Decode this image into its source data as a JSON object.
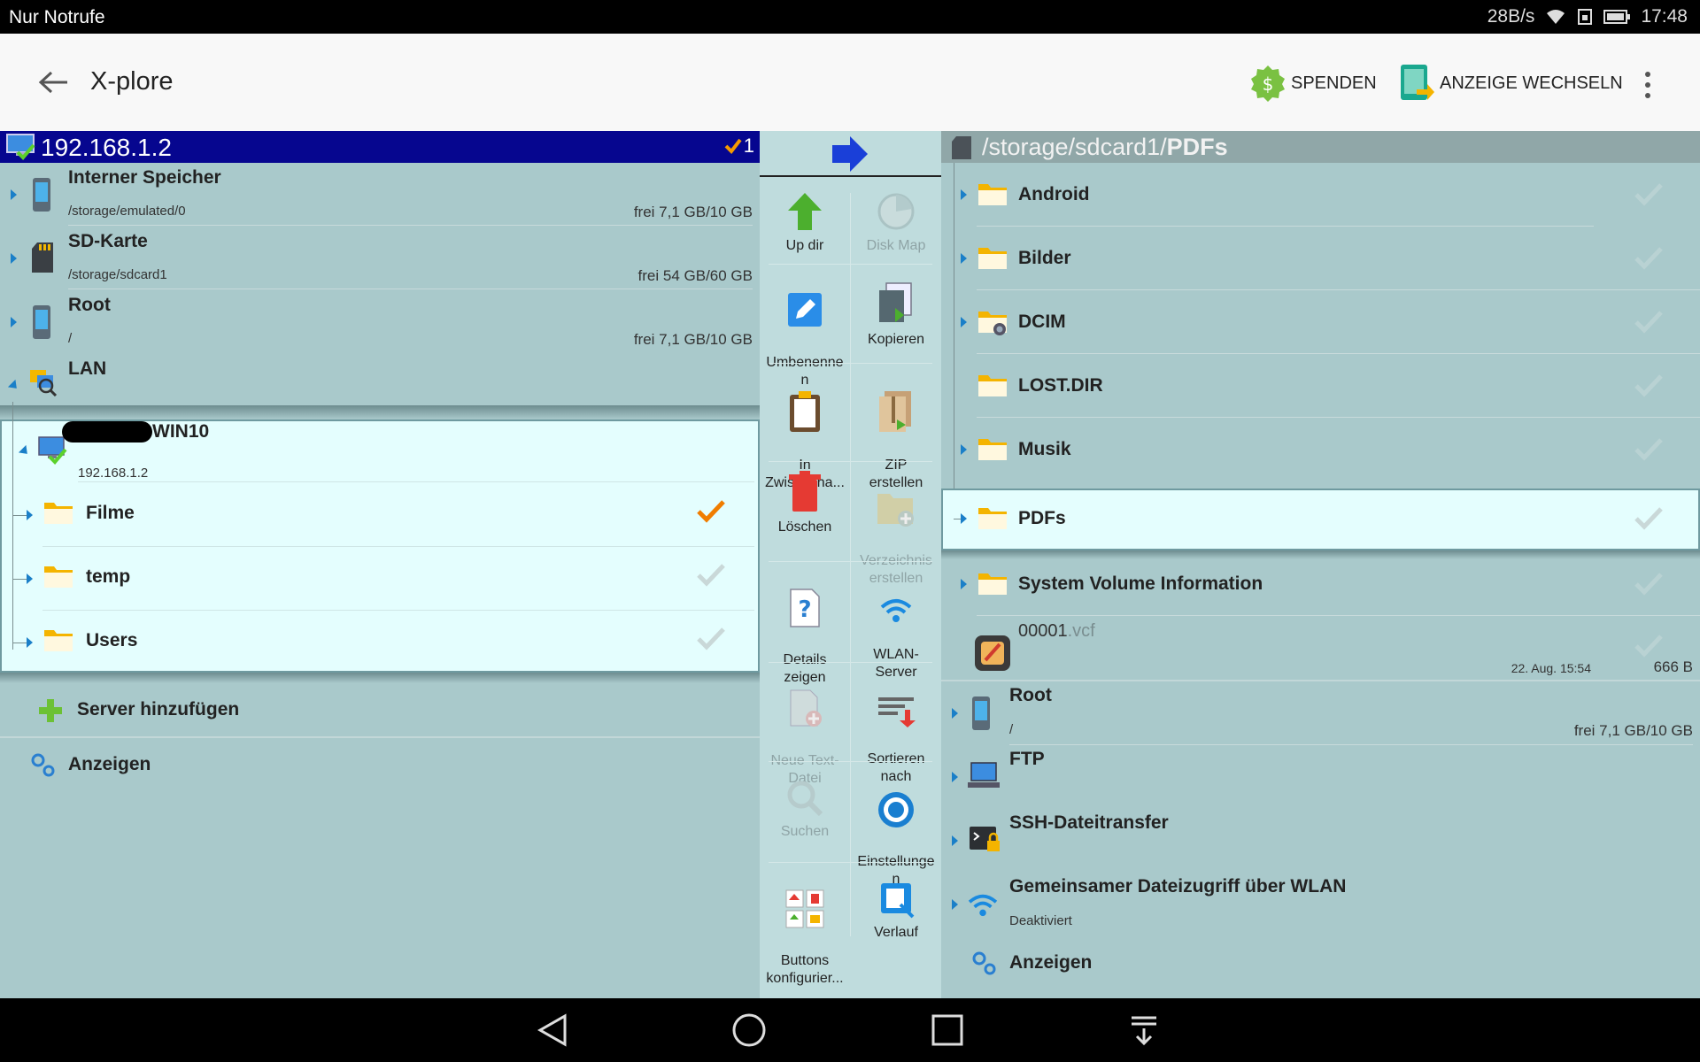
{
  "status_bar": {
    "carrier": "Nur Notrufe",
    "speed": "28B/s",
    "time": "17:48"
  },
  "app_bar": {
    "title": "X-plore",
    "donate_label": "SPENDEN",
    "switch_display_label": "ANZEIGE WECHSELN"
  },
  "left_pane": {
    "path": "192.168.1.2",
    "selected_count": "1",
    "storages": [
      {
        "name": "Interner Speicher",
        "path": "/storage/emulated/0",
        "free": "frei 7,1 GB/10 GB"
      },
      {
        "name": "SD-Karte",
        "path": "/storage/sdcard1",
        "free": "frei 54 GB/60 GB"
      },
      {
        "name": "Root",
        "path": "/",
        "free": "frei 7,1 GB/10 GB"
      }
    ],
    "lan_label": "LAN",
    "server": {
      "name": "WIN10",
      "address": "192.168.1.2"
    },
    "folders": [
      {
        "name": "Filme"
      },
      {
        "name": "temp"
      },
      {
        "name": "Users"
      }
    ],
    "add_server_label": "Server hinzufügen",
    "show_label": "Anzeigen"
  },
  "toolbar": {
    "up_dir": "Up dir",
    "disk_map": "Disk Map",
    "rename": "Umbenenne\nn",
    "copy": "Kopieren",
    "clipboard": "In\nZwischena...",
    "zip": "ZIP\nerstellen",
    "delete": "Löschen",
    "new_folder": "Verzeichnis\nerstellen",
    "details": "Details\nzeigen",
    "wifi_server": "WLAN-\nServer",
    "new_text": "Neue Text-\nDatei",
    "sort": "Sortieren\nnach",
    "search": "Suchen",
    "settings": "Einstellunge\nn",
    "config_buttons": "Buttons\nkonfigurier...",
    "history": "Verlauf"
  },
  "right_pane": {
    "path_prefix": "/storage/sdcard1/",
    "path_current": "PDFs",
    "folders": [
      {
        "name": "Android"
      },
      {
        "name": "Bilder"
      },
      {
        "name": "DCIM"
      },
      {
        "name": "LOST.DIR"
      },
      {
        "name": "Musik"
      },
      {
        "name": "PDFs"
      },
      {
        "name": "System Volume Information"
      }
    ],
    "file": {
      "name": "00001",
      "ext": ".vcf",
      "date": "22. Aug. 15:54",
      "size": "666 B"
    },
    "root": {
      "name": "Root",
      "path": "/",
      "free": "frei 7,1 GB/10 GB"
    },
    "ftp_label": "FTP",
    "ssh_label": "SSH-Dateitransfer",
    "wifi_share": {
      "name": "Gemeinsamer Dateizugriff über WLAN",
      "status": "Deaktiviert"
    },
    "show_label": "Anzeigen"
  }
}
